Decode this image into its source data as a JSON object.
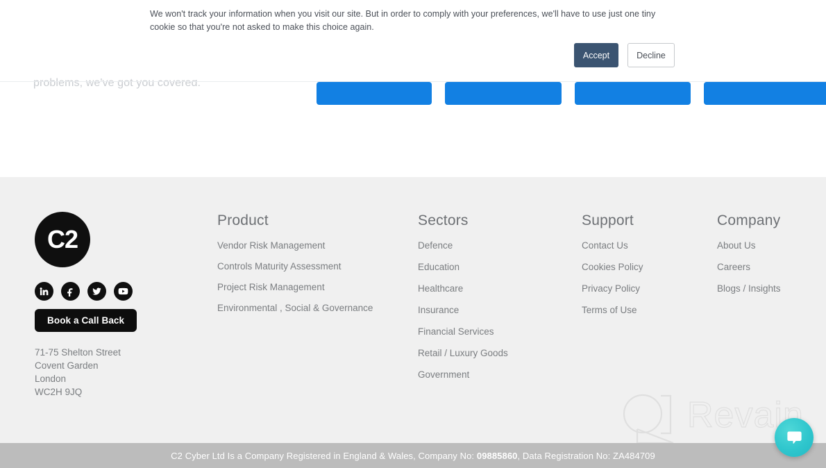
{
  "cookie_banner": {
    "message": "We won't track your information when you visit our site. But in order to comply with your preferences, we'll have to use just one tiny cookie so that you're not asked to make this choice again.",
    "accept_label": "Accept",
    "decline_label": "Decline"
  },
  "top_section": {
    "tagline": "problems, we've got you covered.",
    "cta_buttons": [
      {
        "label": ""
      },
      {
        "label": ""
      },
      {
        "label": ""
      },
      {
        "label": ""
      }
    ]
  },
  "footer": {
    "brand": {
      "logo_text": "C2",
      "callback_label": "Book a Call Back",
      "address": [
        "71-75 Shelton Street",
        "Covent Garden",
        "London",
        "WC2H 9JQ"
      ],
      "social": [
        {
          "name": "linkedin",
          "label": "LinkedIn"
        },
        {
          "name": "facebook",
          "label": "Facebook"
        },
        {
          "name": "twitter",
          "label": "Twitter"
        },
        {
          "name": "youtube",
          "label": "YouTube"
        }
      ]
    },
    "columns": [
      {
        "title": "Product",
        "links": [
          "Vendor Risk Management",
          "Controls Maturity Assessment",
          "Project Risk Management",
          "Environmental , Social & Governance"
        ]
      },
      {
        "title": "Sectors",
        "links": [
          "Defence",
          "Education",
          "Healthcare",
          "Insurance",
          "Financial Services",
          "Retail / Luxury Goods",
          "Government"
        ]
      },
      {
        "title": "Support",
        "links": [
          "Contact Us",
          "Cookies Policy",
          "Privacy Policy",
          "Terms of Use"
        ]
      },
      {
        "title": "Company",
        "links": [
          "About Us",
          "Careers",
          "Blogs / Insights"
        ]
      }
    ],
    "watermark": "Revain"
  },
  "copyright": {
    "prefix": "C2 Cyber Ltd Is a Company Registered in England & Wales, Company No: ",
    "company_no": "09885860",
    "middle": ", Data Registration No: ",
    "data_reg_no": "ZA484709"
  },
  "colors": {
    "cta_blue": "#1280e3",
    "accept_button": "#3b5471",
    "footer_bg": "#f0f0f0",
    "copyright_bar": "#bcbcbc",
    "chat_widget": "#2fc6cd",
    "brand_black": "#0f0f0f"
  }
}
